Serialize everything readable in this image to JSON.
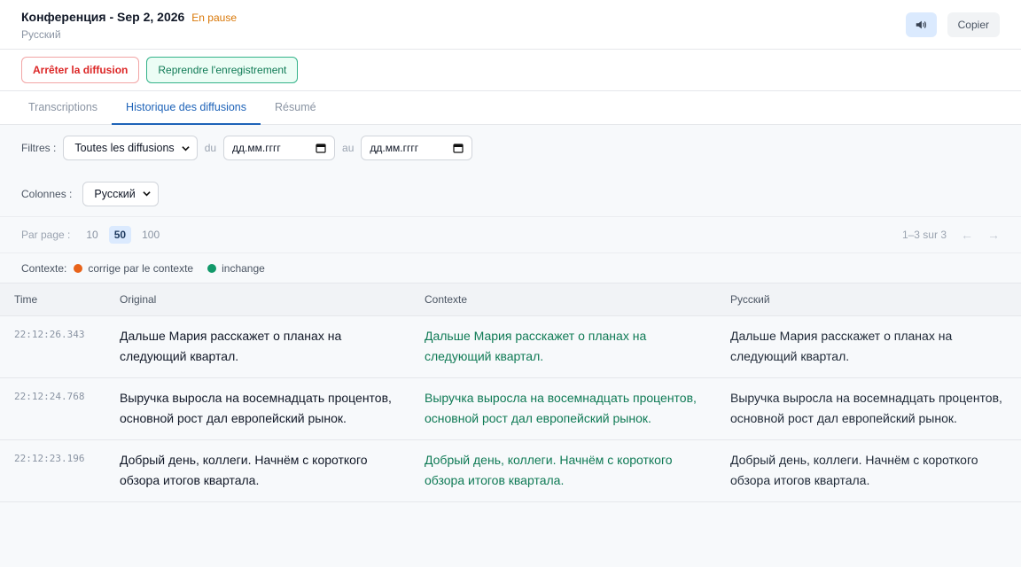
{
  "header": {
    "title": "Конференция - Sep 2, 2026",
    "status": "En pause",
    "subtitle": "Русский",
    "copy_label": "Copier",
    "sound_icon": "speaker-icon"
  },
  "actions": {
    "stop_label": "Arrêter la diffusion",
    "resume_label": "Reprendre l'enregistrement"
  },
  "tabs": [
    {
      "label": "Transcriptions"
    },
    {
      "label": "Historique des diffusions"
    },
    {
      "label": "Résumé"
    }
  ],
  "filters": {
    "label": "Filtres :",
    "broadcast_value": "Toutes les diffusions",
    "from_label": "du",
    "from_placeholder": "дд.мм.гггг",
    "to_label": "au",
    "to_placeholder": "дд.мм.гггг"
  },
  "columns": {
    "label": "Colonnes :",
    "value": "Русский"
  },
  "pagination": {
    "label": "Par page :",
    "options": [
      "10",
      "50",
      "100"
    ],
    "selected": "50",
    "range": "1–3 sur 3",
    "prev": "←",
    "next": "→"
  },
  "legend": {
    "label": "Contexte:",
    "corrected": {
      "label": "corrige par le contexte",
      "color": "#e8631a"
    },
    "unchanged": {
      "label": "inchange",
      "color": "#12996a"
    }
  },
  "table": {
    "headers": {
      "time": "Time",
      "original": "Original",
      "context": "Contexte",
      "lang": "Русский"
    },
    "rows": [
      {
        "time": "22:12:26.343",
        "original": "Дальше Мария расскажет о планах на следующий квартал.",
        "context": "Дальше Мария расскажет о планах на следующий квартал.",
        "lang": "Дальше Мария расскажет о планах на следующий квартал."
      },
      {
        "time": "22:12:24.768",
        "original": "Выручка выросла на восемнадцать процентов, основной рост дал европейский рынок.",
        "context": "Выручка выросла на восемнадцать процентов, основной рост дал европейский рынок.",
        "lang": "Выручка выросла на восемнадцать процентов, основной рост дал европейский рынок."
      },
      {
        "time": "22:12:23.196",
        "original": "Добрый день, коллеги. Начнём с короткого обзора итогов квартала.",
        "context": "Добрый день, коллеги. Начнём с короткого обзора итогов квартала.",
        "lang": "Добрый день, коллеги. Начнём с короткого обзора итогов квартала."
      }
    ]
  }
}
